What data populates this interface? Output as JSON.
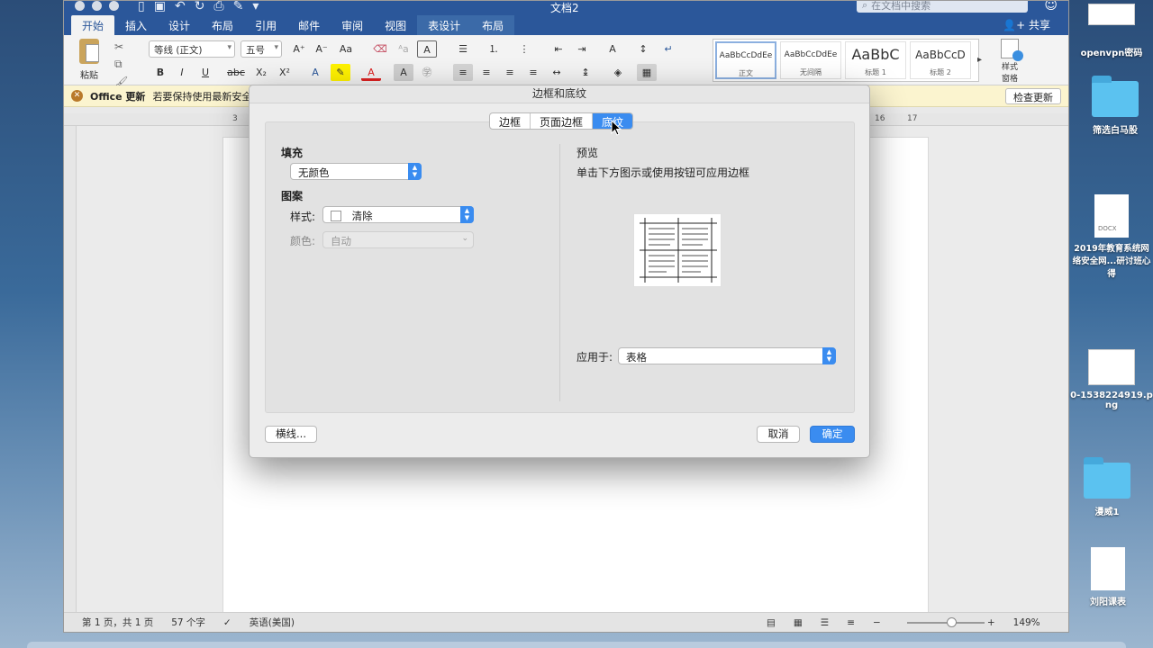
{
  "window": {
    "doc_title": "文档2",
    "search_placeholder": "在文档中搜索",
    "share_label": "共享",
    "tabs": [
      "开始",
      "插入",
      "设计",
      "布局",
      "引用",
      "邮件",
      "审阅",
      "视图",
      "表设计",
      "布局"
    ]
  },
  "ribbon": {
    "paste_label": "粘贴",
    "font_name": "等线 (正文)",
    "font_size": "五号",
    "styles": [
      {
        "sample": "AaBbCcDdEe",
        "name": "正文"
      },
      {
        "sample": "AaBbCcDdEe",
        "name": "无间隔"
      },
      {
        "sample": "AaBbC",
        "name": "标题 1"
      },
      {
        "sample": "AaBbCcD",
        "name": "标题 2"
      }
    ],
    "style_pane_label": "样式\n窗格"
  },
  "message_bar": {
    "title": "Office 更新",
    "text": "若要保持使用最新安全更",
    "button": "检查更新"
  },
  "ruler_marks": [
    "3",
    "16",
    "17"
  ],
  "status": {
    "page": "第 1 页，共 1 页",
    "words": "57 个字",
    "language": "英语(美国)",
    "zoom": "149%"
  },
  "dialog": {
    "title": "边框和底纹",
    "tabs": [
      "边框",
      "页面边框",
      "底纹"
    ],
    "active_tab": "底纹",
    "fill_heading": "填充",
    "fill_value": "无颜色",
    "pattern_heading": "图案",
    "style_label": "样式:",
    "style_value": "清除",
    "color_label": "颜色:",
    "color_value": "自动",
    "preview_heading": "预览",
    "preview_hint": "单击下方图示或使用按钮可应用边框",
    "apply_label": "应用于:",
    "apply_value": "表格",
    "hline_button": "横线...",
    "cancel_button": "取消",
    "ok_button": "确定"
  },
  "desktop": [
    {
      "label": "openvpn密码",
      "kind": "screenshot"
    },
    {
      "label": "筛选白马股",
      "kind": "folder"
    },
    {
      "label": "2019年教育系统网\n络安全网...研讨班心得",
      "kind": "docx",
      "tag": "DOCX"
    },
    {
      "label": "0-1538224919.p\nng",
      "kind": "image"
    },
    {
      "label": "漫威1",
      "kind": "folder"
    },
    {
      "label": "刘阳课表",
      "kind": "file"
    }
  ]
}
